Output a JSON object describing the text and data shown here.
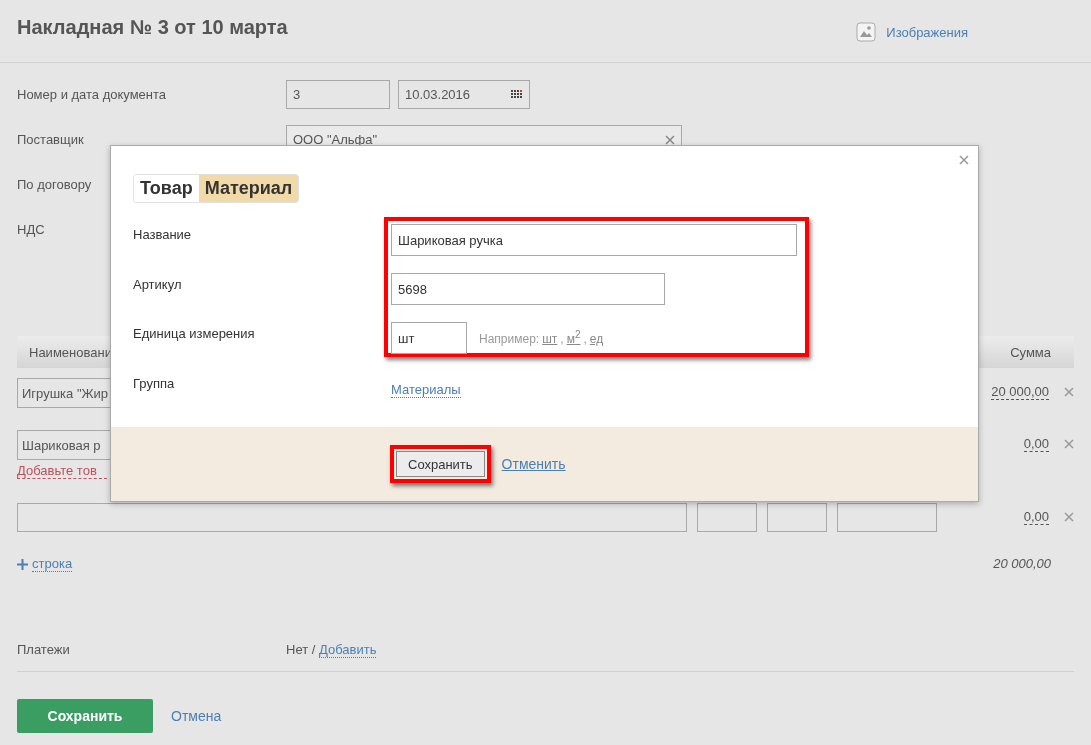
{
  "header": {
    "title": "Накладная № 3 от 10 марта",
    "images_link": "Изображения"
  },
  "form": {
    "number_date": {
      "label": "Номер и дата документа",
      "number": "3",
      "date": "10.03.2016"
    },
    "supplier": {
      "label": "Поставщик",
      "value": "ООО \"Альфа\""
    },
    "contract": {
      "label": "По договору"
    },
    "vat": {
      "label": "НДС"
    }
  },
  "table": {
    "columns": [
      {
        "label": "Наименовани"
      },
      {
        "label": "Сумма"
      }
    ],
    "rows": [
      {
        "kind": "item",
        "name": "Игрушка \"Жир",
        "sum": "20 000,00"
      },
      {
        "kind": "item",
        "name": "Шариковая р",
        "sum": "0,00",
        "warning": "Добавьте тов"
      },
      {
        "kind": "empty",
        "sum": "0,00"
      }
    ],
    "add_row": "строка",
    "total": "20 000,00"
  },
  "payments": {
    "label": "Платежи",
    "value": "Нет /",
    "link": "Добавить"
  },
  "footer": {
    "save": "Сохранить",
    "cancel": "Отмена"
  },
  "dialog": {
    "tabs": [
      {
        "label": "Товар",
        "selected": false
      },
      {
        "label": "Материал",
        "selected": true
      }
    ],
    "fields": [
      {
        "kind": "text",
        "label": "Название",
        "value": "Шариковая ручка"
      },
      {
        "kind": "text",
        "label": "Артикул",
        "value": "5698"
      },
      {
        "kind": "unit",
        "label": "Единица измерения",
        "value": "шт"
      },
      {
        "kind": "link",
        "label": "Группа",
        "value": "Материалы"
      }
    ],
    "unit_hint": {
      "prefix": "Например:",
      "examples": [
        "шт",
        "м$^{2}$",
        "ед"
      ],
      "separator": ","
    },
    "highlight_fields": true,
    "highlight_save": true,
    "save": "Сохранить",
    "cancel": "Отменить"
  }
}
